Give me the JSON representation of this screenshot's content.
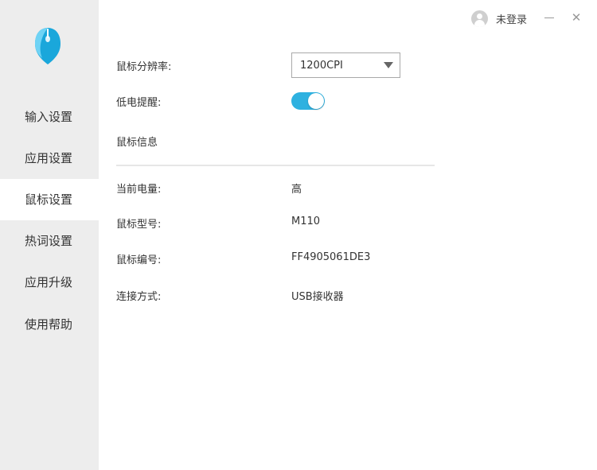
{
  "sidebar": {
    "logo": "mouse-logo-icon",
    "items": [
      {
        "label": "输入设置"
      },
      {
        "label": "应用设置"
      },
      {
        "label": "鼠标设置",
        "active": true
      },
      {
        "label": "热词设置"
      },
      {
        "label": "应用升级"
      },
      {
        "label": "使用帮助"
      }
    ]
  },
  "titlebar": {
    "user_icon": "user-avatar-icon",
    "login_label": "未登录",
    "minimize_icon": "minimize-icon",
    "close_icon": "close-icon",
    "close_glyph": "✕"
  },
  "settings": {
    "resolution": {
      "label": "鼠标分辨率:",
      "value": "1200CPI"
    },
    "low_battery": {
      "label": "低电提醒:",
      "enabled": true
    }
  },
  "mouse_info": {
    "heading": "鼠标信息",
    "rows": [
      {
        "label": "当前电量:",
        "value": "高"
      },
      {
        "label": "鼠标型号:",
        "value": "M110"
      },
      {
        "label": "鼠标编号:",
        "value": "FF4905061DE3"
      },
      {
        "label": "连接方式:",
        "value": "USB接收器"
      }
    ]
  },
  "colors": {
    "accent": "#2eb1e0",
    "sidebar_bg": "#ededed",
    "logo_light": "#6fd3f5",
    "logo_dark": "#1aa7db"
  }
}
